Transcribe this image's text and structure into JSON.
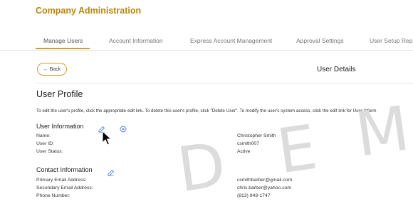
{
  "header": {
    "title": "Company Administration"
  },
  "tabs": [
    {
      "label": "Manage Users"
    },
    {
      "label": "Account Information"
    },
    {
      "label": "Express Account Management"
    },
    {
      "label": "Approval Settings"
    },
    {
      "label": "User Setup Repor"
    }
  ],
  "toolbar": {
    "back_label": "Back",
    "section_title": "User Details"
  },
  "profile": {
    "title": "User Profile",
    "intro": "To edit the user's profile, click the appropriate edit link. To delete this user's profile, click \"Delete User\". To modify the user's system access, click the edit link for User Inform"
  },
  "user_info": {
    "heading": "User Information",
    "rows": [
      {
        "label": "Name:",
        "value": "Christopher Smith"
      },
      {
        "label": "User ID:",
        "value": "csmith007"
      },
      {
        "label": "User Status:",
        "value": "Active"
      }
    ]
  },
  "contact_info": {
    "heading": "Contact Information",
    "rows": [
      {
        "label": "Primary Email Address:",
        "value": "csmithbarber@gmail.com"
      },
      {
        "label": "Secondary Email Address:",
        "value": "chris.barber@yahoo.com"
      },
      {
        "label": "Phone Number:",
        "value": "(813) 949-1747"
      }
    ]
  },
  "watermark": {
    "letters": [
      "D",
      "E",
      "M"
    ]
  },
  "colors": {
    "brand": "#b8860b",
    "accent": "#c9a227",
    "icon": "#5b7fd6"
  },
  "icons": [
    "edit-icon",
    "cancel-icon",
    "back-arrow-icon",
    "mouse-cursor-icon"
  ]
}
